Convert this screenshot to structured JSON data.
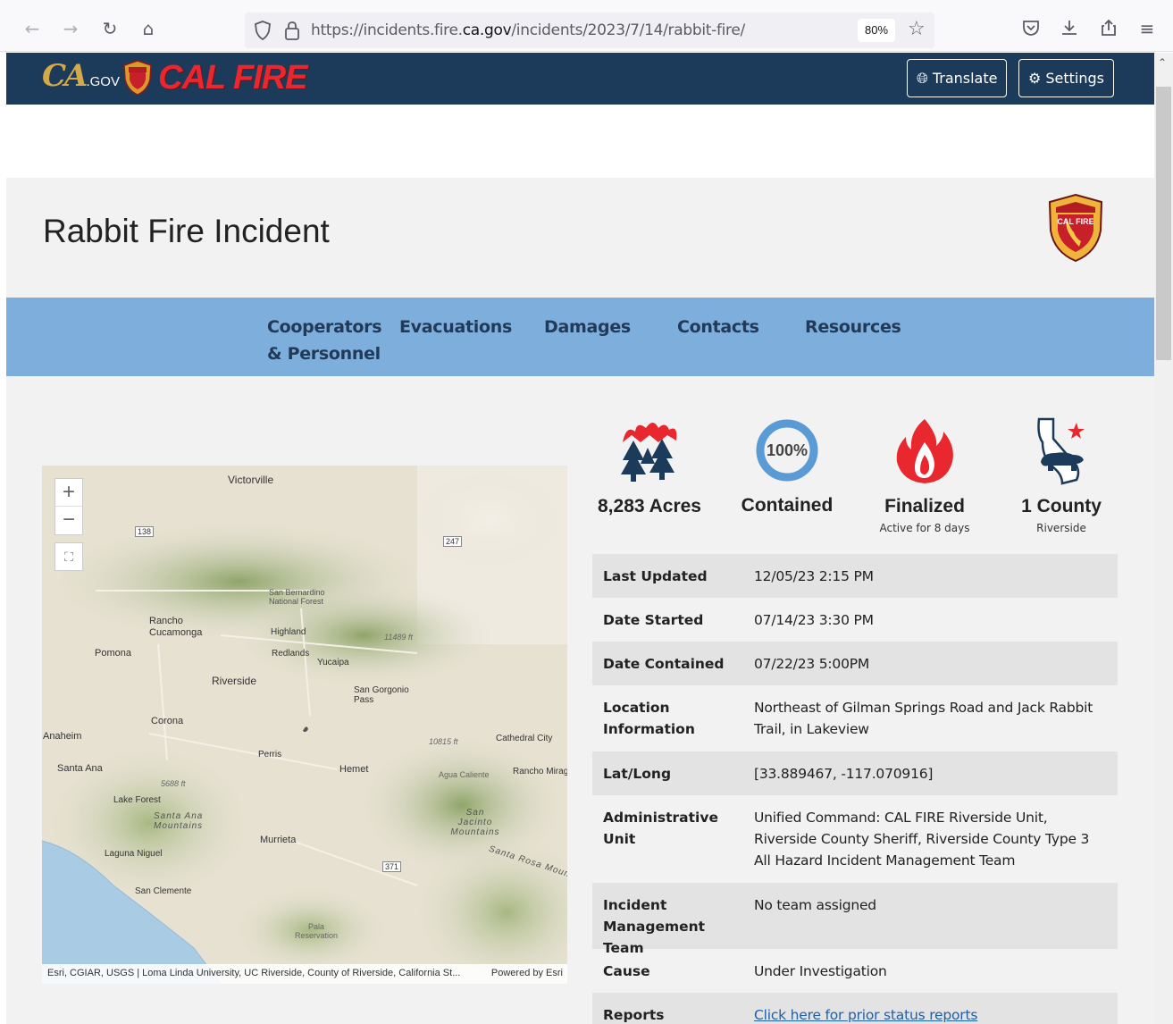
{
  "browser": {
    "url_prefix": "https://incidents.fire.",
    "url_domain": "ca.gov",
    "url_path": "/incidents/2023/7/14/rabbit-fire/",
    "zoom": "80%",
    "icons": [
      "back-icon",
      "forward-icon",
      "reload-icon",
      "home-icon",
      "shield-icon",
      "lock-icon",
      "bookmark-star-icon",
      "pocket-icon",
      "download-icon",
      "share-icon",
      "menu-icon"
    ]
  },
  "header": {
    "ca_logo": "CA",
    "ca_logo_suffix": ".GOV",
    "brand": "CAL FIRE",
    "translate_label": "Translate",
    "settings_label": "Settings",
    "bg_color": "#1c3a5a"
  },
  "page": {
    "title": "Rabbit Fire Incident",
    "badge_text": "CAL FIRE"
  },
  "tabs": [
    {
      "line1": "Cooperators",
      "line2": "& Personnel"
    },
    {
      "line1": "Evacuations",
      "line2": ""
    },
    {
      "line1": "Damages",
      "line2": ""
    },
    {
      "line1": "Contacts",
      "line2": ""
    },
    {
      "line1": "Resources",
      "line2": ""
    }
  ],
  "map": {
    "labels": [
      "Victorville",
      "Rancho Cucamonga",
      "Pomona",
      "Riverside",
      "Highland",
      "Redlands",
      "Yucaipa",
      "San Gorgonio Pass",
      "San Bernardino National Forest",
      "Corona",
      "Anaheim",
      "Perris",
      "Hemet",
      "Cathedral City",
      "Rancho Mirag",
      "Santa Ana",
      "Lake Forest",
      "Santa Ana Mountains",
      "Murrieta",
      "Laguna Niguel",
      "San Clemente",
      "San Jacinto Mountains",
      "Agua Caliente",
      "Santa Rosa Moun",
      "Pala Reservation",
      "11489 ft",
      "10815 ft",
      "5688 ft",
      "138",
      "247",
      "371"
    ],
    "attribution": "Esri, CGIAR, USGS | Loma Linda University, UC Riverside, County of Riverside, California St...",
    "powered_by": "Powered by Esri",
    "zoom_in": "+",
    "zoom_out": "−"
  },
  "stats": [
    {
      "value": "8,283 Acres",
      "sub": "",
      "icon": "burning-trees-icon"
    },
    {
      "value": "Contained",
      "sub": "",
      "icon": "containment-ring-icon",
      "percent_label": "100%",
      "percent": 100
    },
    {
      "value": "Finalized",
      "sub": "Active for 8 days",
      "icon": "flame-icon"
    },
    {
      "value": "1 County",
      "sub": "Riverside",
      "icon": "california-bear-icon"
    }
  ],
  "info": [
    {
      "key": "Last Updated",
      "value": "12/05/23 2:15 PM"
    },
    {
      "key": "Date Started",
      "value": "07/14/23 3:30 PM"
    },
    {
      "key": "Date Contained",
      "value": "07/22/23 5:00PM"
    },
    {
      "key": "Location Information",
      "value": "Northeast of Gilman Springs Road and Jack Rabbit Trail, in Lakeview"
    },
    {
      "key": "Lat/Long",
      "value": "[33.889467, -117.070916]"
    },
    {
      "key": "Administrative Unit",
      "value": "Unified Command: CAL FIRE Riverside Unit, Riverside County Sheriff, Riverside County Type 3 All Hazard Incident Management Team"
    },
    {
      "key": "Incident Management Team",
      "value": "No team assigned"
    },
    {
      "key": "Cause",
      "value": "Under Investigation"
    },
    {
      "key": "Reports",
      "value": "Click here for prior status reports"
    }
  ],
  "colors": {
    "tab_bar": "#7eaedc",
    "tab_text": "#213a57",
    "fire_red": "#e8282e",
    "ring_blue": "#5b9bd5"
  }
}
